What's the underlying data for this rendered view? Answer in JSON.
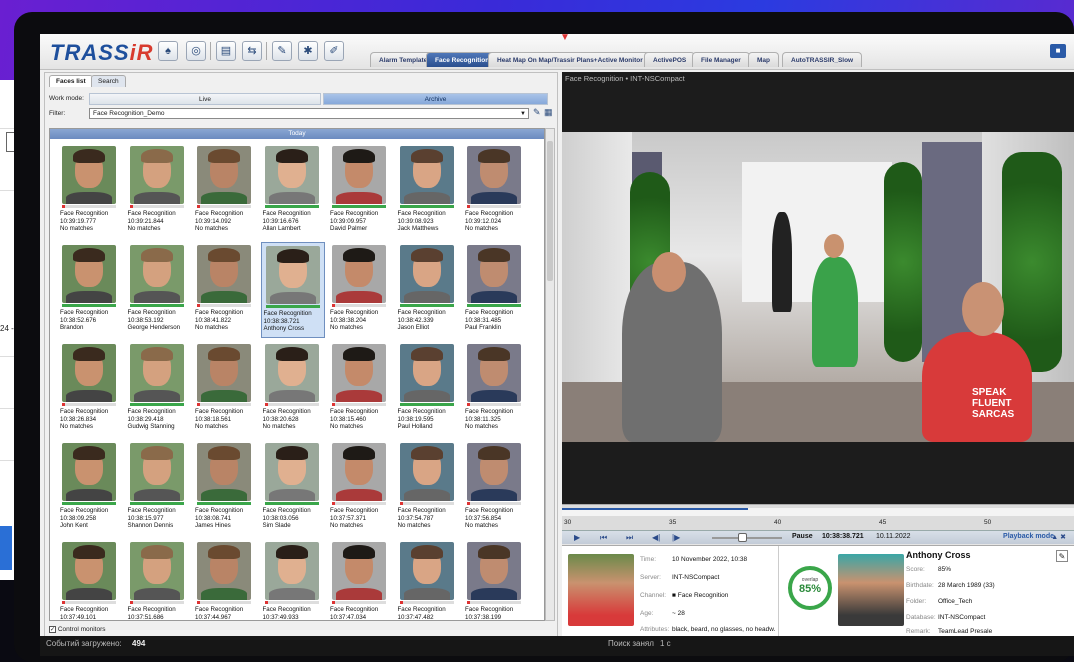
{
  "app": {
    "logo_main": "TRASS",
    "logo_accent": "iR",
    "tabs": [
      {
        "label": "Alarm Template",
        "active": false
      },
      {
        "label": "Face Recognition",
        "active": true
      },
      {
        "label": "Heat Map On Map/Trassir Plans+Active Monitor",
        "active": false
      },
      {
        "label": "ActivePOS",
        "active": false
      },
      {
        "label": "File Manager",
        "active": false
      },
      {
        "label": "Map",
        "active": false
      },
      {
        "label": "AutoTRASSIR_Slow",
        "active": false
      }
    ]
  },
  "left": {
    "tab_faces": "Faces list",
    "tab_search": "Search",
    "work_mode_label": "Work mode:",
    "mode_live": "Live",
    "mode_archive": "Archive",
    "filter_label": "Filter:",
    "filter_value": "Face Recognition_Demo",
    "group_header": "Today",
    "control_monitors": "Control monitors",
    "faces": [
      {
        "title": "Face Recognition",
        "time": "10:39:19.777",
        "name": "No matches",
        "match": false
      },
      {
        "title": "Face Recognition",
        "time": "10:39:21.844",
        "name": "No matches",
        "match": false
      },
      {
        "title": "Face Recognition",
        "time": "10:39:14.092",
        "name": "No matches",
        "match": false
      },
      {
        "title": "Face Recognition",
        "time": "10:39:16.676",
        "name": "Allan Lambert",
        "match": true
      },
      {
        "title": "Face Recognition",
        "time": "10:39:09.957",
        "name": "David Palmer",
        "match": true
      },
      {
        "title": "Face Recognition",
        "time": "10:39:08.923",
        "name": "Jack Matthews",
        "match": true
      },
      {
        "title": "Face Recognition",
        "time": "10:39:12.024",
        "name": "No matches",
        "match": false
      },
      {
        "title": "Face Recognition",
        "time": "10:38:52.676",
        "name": "Brandon",
        "match": true
      },
      {
        "title": "Face Recognition",
        "time": "10:38:53.192",
        "name": "George Henderson",
        "match": true
      },
      {
        "title": "Face Recognition",
        "time": "10:38:41.822",
        "name": "No matches",
        "match": false
      },
      {
        "title": "Face Recognition",
        "time": "10:38:38.721",
        "name": "Anthony Cross",
        "match": true,
        "selected": true
      },
      {
        "title": "Face Recognition",
        "time": "10:38:38.204",
        "name": "No matches",
        "match": false
      },
      {
        "title": "Face Recognition",
        "time": "10:38:42.339",
        "name": "Jason Elliot",
        "match": true
      },
      {
        "title": "Face Recognition",
        "time": "10:38:31.485",
        "name": "Paul Franklin",
        "match": true
      },
      {
        "title": "Face Recognition",
        "time": "10:38:26.834",
        "name": "No matches",
        "match": false
      },
      {
        "title": "Face Recognition",
        "time": "10:38:29.418",
        "name": "Gudwig Stanning",
        "match": true
      },
      {
        "title": "Face Recognition",
        "time": "10:38:18.561",
        "name": "No matches",
        "match": false
      },
      {
        "title": "Face Recognition",
        "time": "10:38:20.628",
        "name": "No matches",
        "match": false
      },
      {
        "title": "Face Recognition",
        "time": "10:38:15.460",
        "name": "No matches",
        "match": false
      },
      {
        "title": "Face Recognition",
        "time": "10:38:19.595",
        "name": "Paul Holland",
        "match": true
      },
      {
        "title": "Face Recognition",
        "time": "10:38:11.325",
        "name": "No matches",
        "match": false
      },
      {
        "title": "Face Recognition",
        "time": "10:38:09.258",
        "name": "John Kent",
        "match": true
      },
      {
        "title": "Face Recognition",
        "time": "10:38:15.977",
        "name": "Shannon Dennis",
        "match": true
      },
      {
        "title": "Face Recognition",
        "time": "10:38:08.741",
        "name": "James Hines",
        "match": true
      },
      {
        "title": "Face Recognition",
        "time": "10:38:03.056",
        "name": "Sim Slade",
        "match": true
      },
      {
        "title": "Face Recognition",
        "time": "10:37:57.371",
        "name": "No matches",
        "match": false
      },
      {
        "title": "Face Recognition",
        "time": "10:37:54.787",
        "name": "No matches",
        "match": false
      },
      {
        "title": "Face Recognition",
        "time": "10:37:56.854",
        "name": "No matches",
        "match": false
      },
      {
        "title": "Face Recognition",
        "time": "10:37:49.101",
        "name": "",
        "match": false
      },
      {
        "title": "Face Recognition",
        "time": "10:37:51.686",
        "name": "",
        "match": false
      },
      {
        "title": "Face Recognition",
        "time": "10:37:44.967",
        "name": "",
        "match": false
      },
      {
        "title": "Face Recognition",
        "time": "10:37:49.933",
        "name": "",
        "match": false
      },
      {
        "title": "Face Recognition",
        "time": "10:37:47.034",
        "name": "",
        "match": false
      },
      {
        "title": "Face Recognition",
        "time": "10:37:47.482",
        "name": "",
        "match": false
      },
      {
        "title": "Face Recognition",
        "time": "10:37:38.199",
        "name": "",
        "match": false
      }
    ]
  },
  "video": {
    "title": "Face Recognition  •  INT-NSCompact",
    "ticks": [
      "30",
      "35",
      "40",
      "45",
      "50"
    ],
    "status": "Pause",
    "time": "10:38:38.721",
    "date": "10.11.2022",
    "mode": "Playback mode",
    "overlay_text": [
      "SPEAK",
      "FLUENT",
      "SARCAS"
    ]
  },
  "detail": {
    "time_label": "Time:",
    "time_value": "10 November 2022, 10:38",
    "server_label": "Server:",
    "server_value": "INT-NSCompact",
    "channel_label": "Channel:",
    "channel_value": "Face Recognition",
    "age_label": "Age:",
    "age_value": "~ 28",
    "attr_label": "Attributes:",
    "attr_value": "black, beard, no glasses, no headw.",
    "overlap_label": "overlap",
    "overlap_value": "85%",
    "person_name": "Anthony Cross",
    "score_label": "Score:",
    "score_value": "85%",
    "birth_label": "Birthdate:",
    "birth_value": "28 March 1989 (33)",
    "folder_label": "Folder:",
    "folder_value": "Office_Tech",
    "db_label": "Database:",
    "db_value": "INT-NSCompact",
    "remark_label": "Remark:",
    "remark_value": "TeamLead Presale"
  },
  "background": {
    "left_doc_text": "24 - 0",
    "status_left": "Событий загружено:",
    "status_count": "494",
    "status_right": "Поиск занял",
    "status_right_value": "1 с"
  }
}
